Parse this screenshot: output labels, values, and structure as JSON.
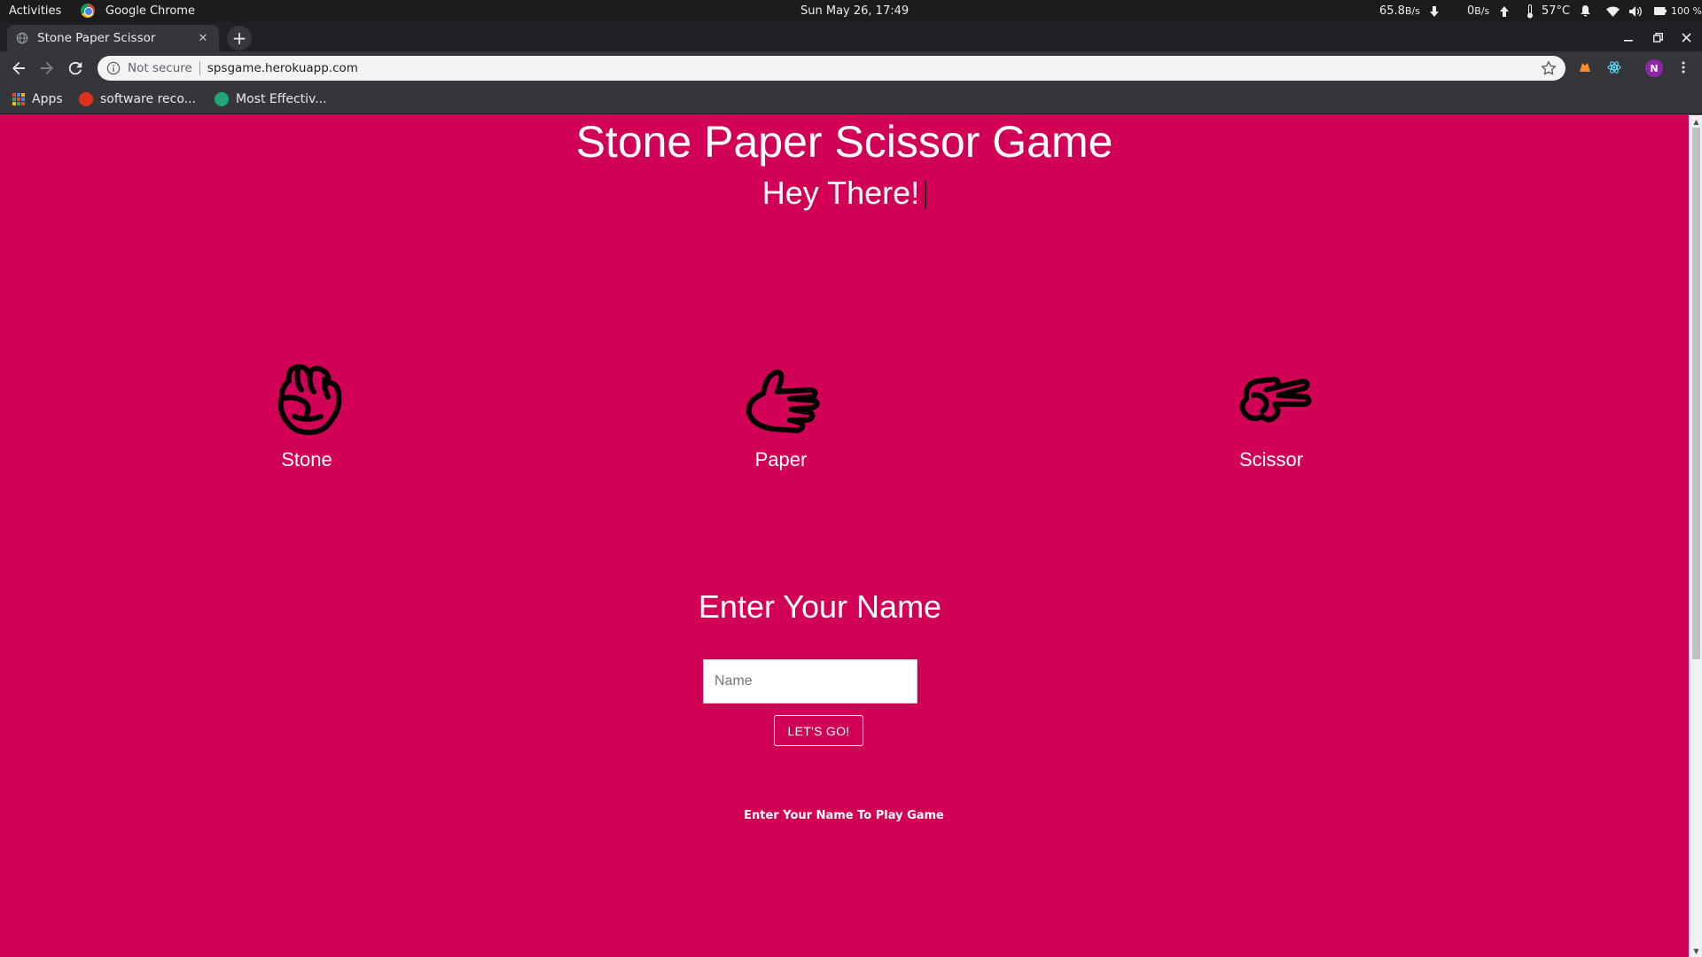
{
  "system_bar": {
    "activities": "Activities",
    "app_name": "Google Chrome",
    "clock": "Sun May 26, 17:49",
    "net_down": "65.8",
    "net_down_unit": "B/s",
    "net_up": "0",
    "net_up_unit": "B/s",
    "temperature": "57°C",
    "battery": "100 %"
  },
  "browser": {
    "tab_title": "Stone Paper Scissor",
    "security_label": "Not secure",
    "url": "spsgame.herokuapp.com",
    "profile_initial": "N",
    "bookmarks": [
      {
        "label": "Apps"
      },
      {
        "label": "software reco..."
      },
      {
        "label": "Most Effectiv..."
      }
    ]
  },
  "page": {
    "title": "Stone Paper Scissor Game",
    "greeting": "Hey There!",
    "choices": [
      {
        "label": "Stone",
        "icon": "fist-icon"
      },
      {
        "label": "Paper",
        "icon": "open-hand-icon"
      },
      {
        "label": "Scissor",
        "icon": "scissor-hand-icon"
      }
    ],
    "name_heading": "Enter Your Name",
    "name_placeholder": "Name",
    "go_button": "LET'S GO!",
    "hint": "Enter Your Name To Play Game"
  },
  "colors": {
    "page_background": "#d10056",
    "text": "#ffffff"
  }
}
